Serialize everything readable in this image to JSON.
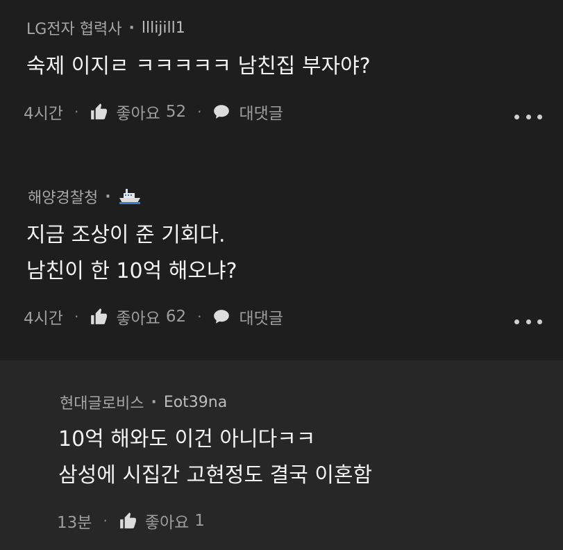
{
  "comments": [
    {
      "author": "LG전자 협력사",
      "nickname": "lllijill1",
      "lines": [
        "숙제 이지ㄹ ㅋㅋㅋㅋㅋ 남친집 부자야?"
      ],
      "time": "4시간",
      "like_label": "좋아요",
      "like_count": "52",
      "reply_label": "대댓글"
    },
    {
      "author": "해양경찰청",
      "nickname_icon": "ship-icon",
      "lines": [
        "지금 조상이 준 기회다.",
        "남친이 한 10억 해오냐?"
      ],
      "time": "4시간",
      "like_label": "좋아요",
      "like_count": "62",
      "reply_label": "대댓글"
    },
    {
      "author": "현대글로비스",
      "nickname": "Eot39na",
      "lines": [
        "10억 해와도 이건 아니다ㅋㅋ",
        "삼성에 시집간 고현정도 결국 이혼함"
      ],
      "time": "13분",
      "like_label": "좋아요",
      "like_count": "1"
    }
  ],
  "separator": "·",
  "colors": {
    "background": "#1e1e1e",
    "reply_background": "#272727",
    "text": "#f3f3f3",
    "meta": "#a7a7a7"
  }
}
